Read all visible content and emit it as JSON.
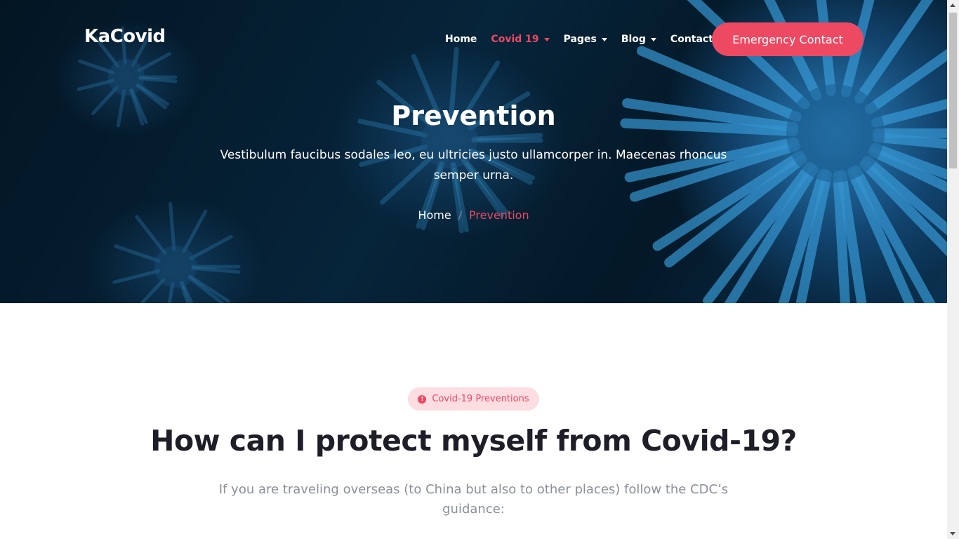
{
  "brand": {
    "name": "KaCovid"
  },
  "nav": {
    "items": [
      {
        "label": "Home",
        "dropdown": false
      },
      {
        "label": "Covid 19",
        "dropdown": true
      },
      {
        "label": "Pages",
        "dropdown": true
      },
      {
        "label": "Blog",
        "dropdown": true
      },
      {
        "label": "Contact",
        "dropdown": false
      }
    ],
    "cta_label": "Emergency Contact"
  },
  "hero": {
    "title": "Prevention",
    "subtitle": "Vestibulum faucibus sodales leo, eu ultricies justo ullamcorper in. Maecenas rhoncus semper urna.",
    "breadcrumb": {
      "home": "Home",
      "separator": "/",
      "current": "Prevention"
    }
  },
  "section": {
    "badge": "Covid-19 Preventions",
    "badge_icon": "info-circle-icon",
    "title": "How can I protect myself from Covid-19?",
    "text": "If you are traveling overseas (to China but also to other places) follow the CDC’s guidance:"
  },
  "colors": {
    "accent": "#ee4962",
    "badge_bg": "#fbdde2",
    "hero_dark": "#031523",
    "virus_blue": "#2c82be"
  }
}
